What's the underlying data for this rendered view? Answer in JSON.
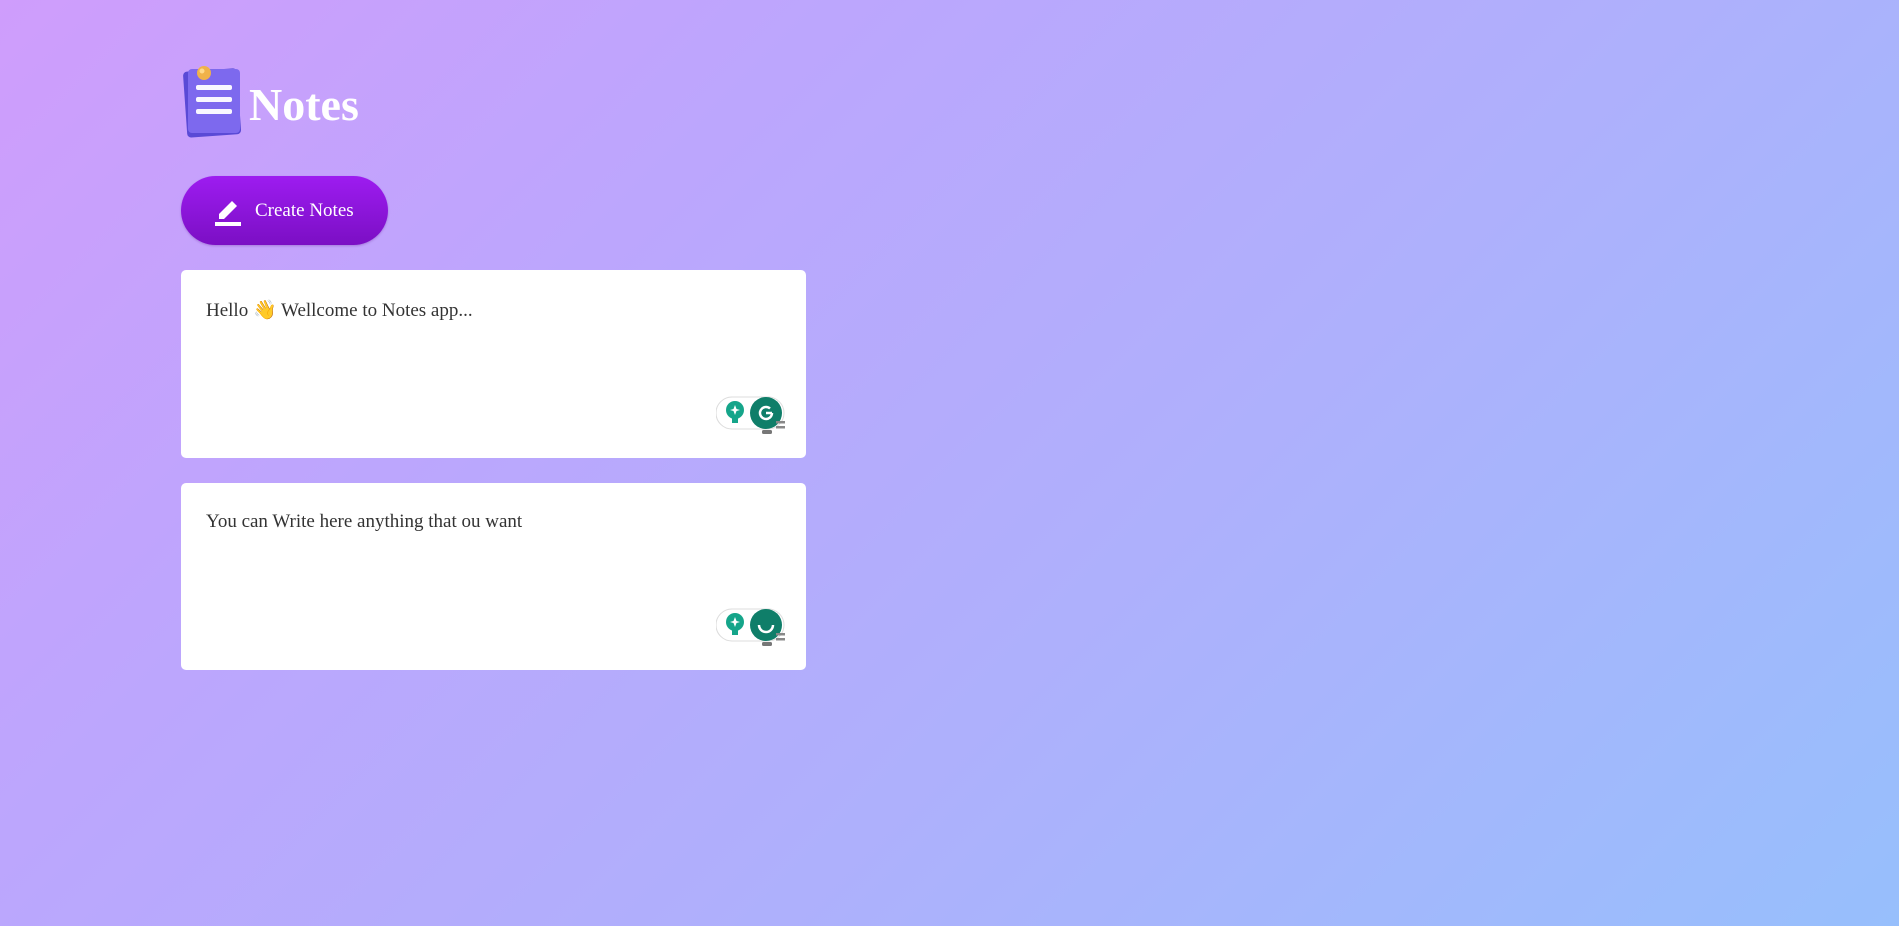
{
  "app": {
    "title": "Notes",
    "logo_icon": "notes-logo-icon"
  },
  "toolbar": {
    "create_label": "Create Notes",
    "create_icon": "pencil-icon"
  },
  "notes": [
    {
      "text": "Hello 👋 Wellcome to Notes app..."
    },
    {
      "text": "You can Write here anything that ou want"
    }
  ],
  "colors": {
    "background_start": "#cf9dfc",
    "background_end": "#97bffc",
    "button_start": "#9d1cf0",
    "button_end": "#7b0fc4",
    "note_bg": "#ffffff",
    "grammarly_green": "#15a58a"
  }
}
